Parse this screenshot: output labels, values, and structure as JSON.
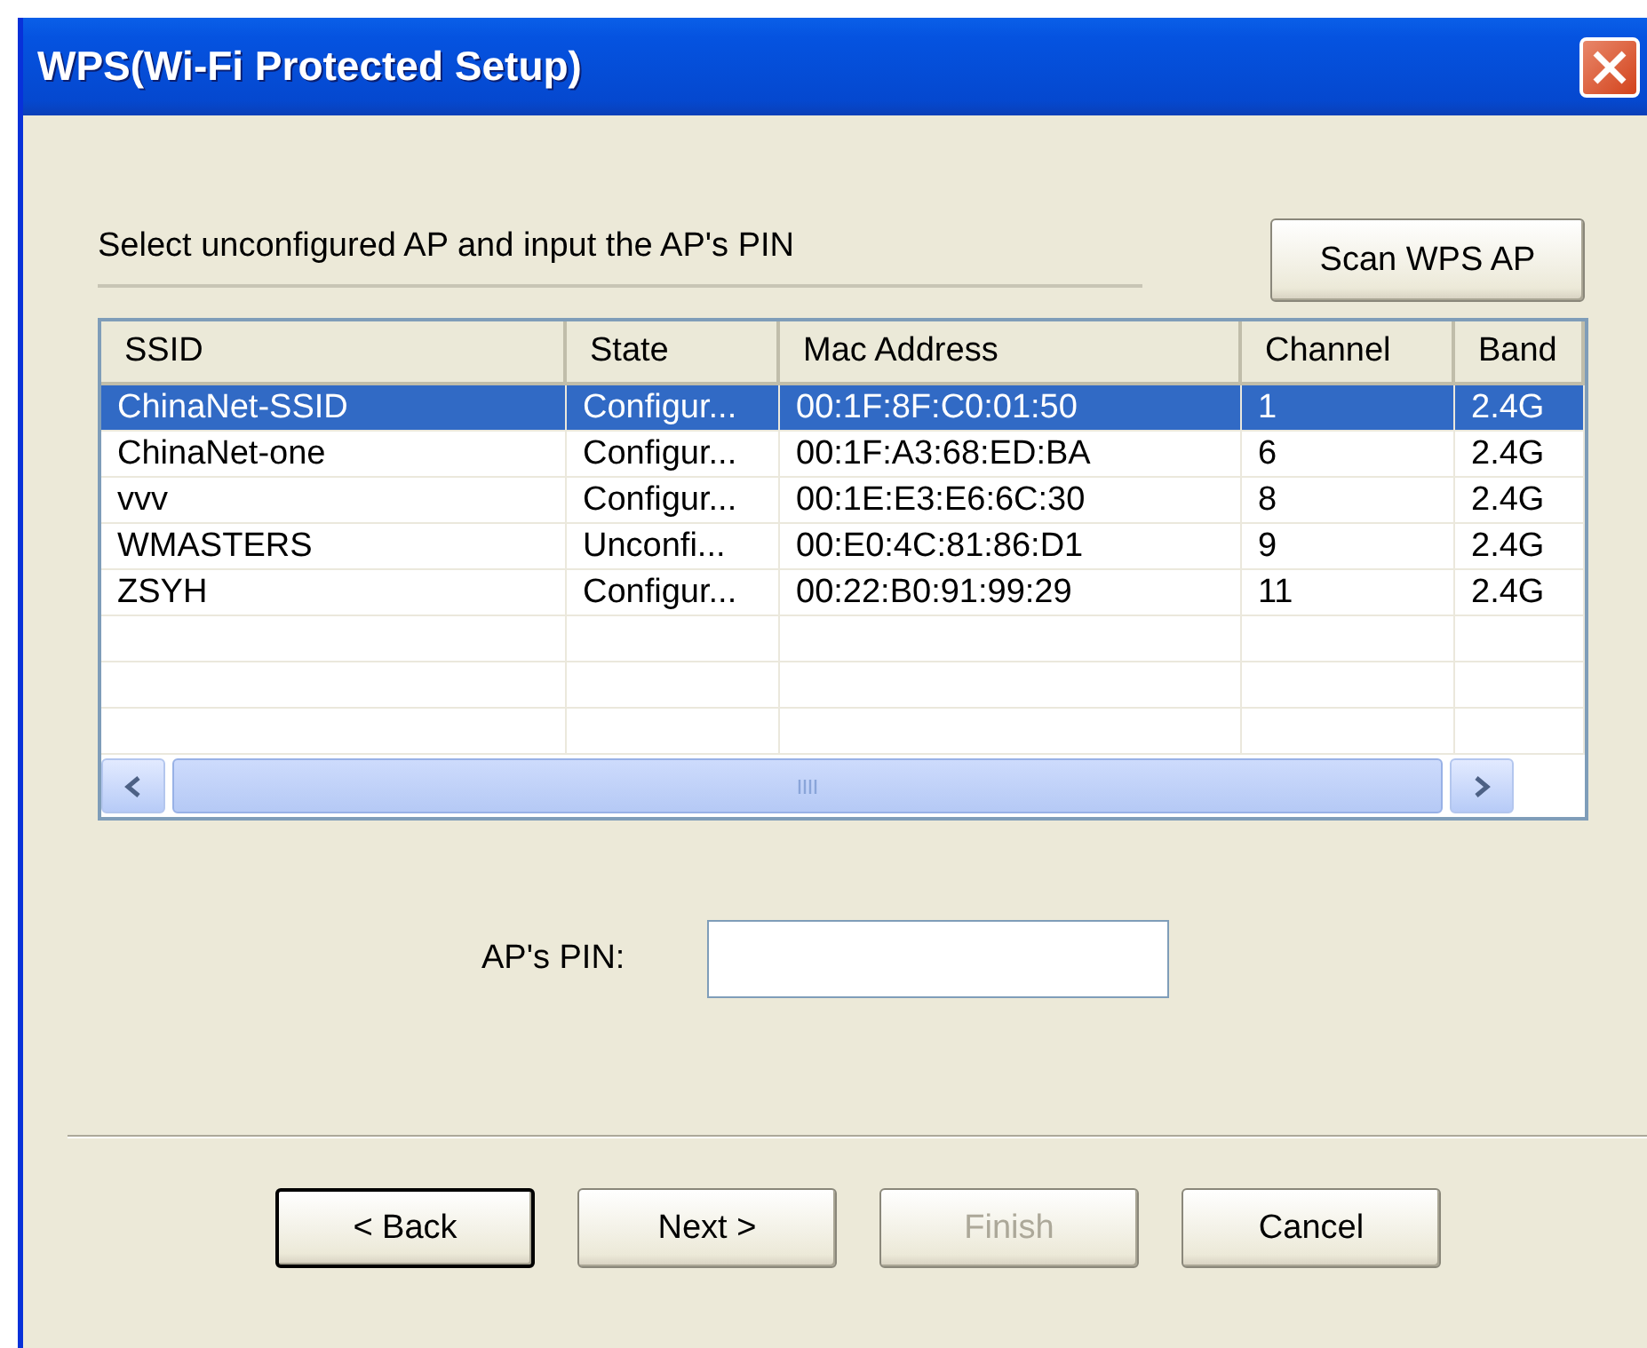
{
  "window": {
    "title": "WPS(Wi-Fi Protected Setup)"
  },
  "instruction": "Select unconfigured AP and input the AP's PIN",
  "scan_button": {
    "label": "Scan WPS AP"
  },
  "table": {
    "columns": [
      "SSID",
      "State",
      "Mac Address",
      "Channel",
      "Band"
    ],
    "rows": [
      {
        "cells": [
          "ChinaNet-SSID",
          "Configur...",
          "00:1F:8F:C0:01:50",
          "1",
          "2.4G"
        ],
        "selected": true
      },
      {
        "cells": [
          "ChinaNet-one",
          "Configur...",
          "00:1F:A3:68:ED:BA",
          "6",
          "2.4G"
        ],
        "selected": false
      },
      {
        "cells": [
          "vvv",
          "Configur...",
          "00:1E:E3:E6:6C:30",
          "8",
          "2.4G"
        ],
        "selected": false
      },
      {
        "cells": [
          "WMASTERS",
          "Unconfi...",
          "00:E0:4C:81:86:D1",
          "9",
          "2.4G"
        ],
        "selected": false
      },
      {
        "cells": [
          "ZSYH",
          "Configur...",
          "00:22:B0:91:99:29",
          "11",
          "2.4G"
        ],
        "selected": false
      }
    ]
  },
  "pin": {
    "label": "AP's PIN:"
  },
  "buttons": [
    {
      "label": "< Back",
      "default": true,
      "disabled": false
    },
    {
      "label": "Next >",
      "default": false,
      "disabled": false
    },
    {
      "label": "Finish",
      "default": false,
      "disabled": true
    },
    {
      "label": "Cancel",
      "default": false,
      "disabled": false
    }
  ]
}
